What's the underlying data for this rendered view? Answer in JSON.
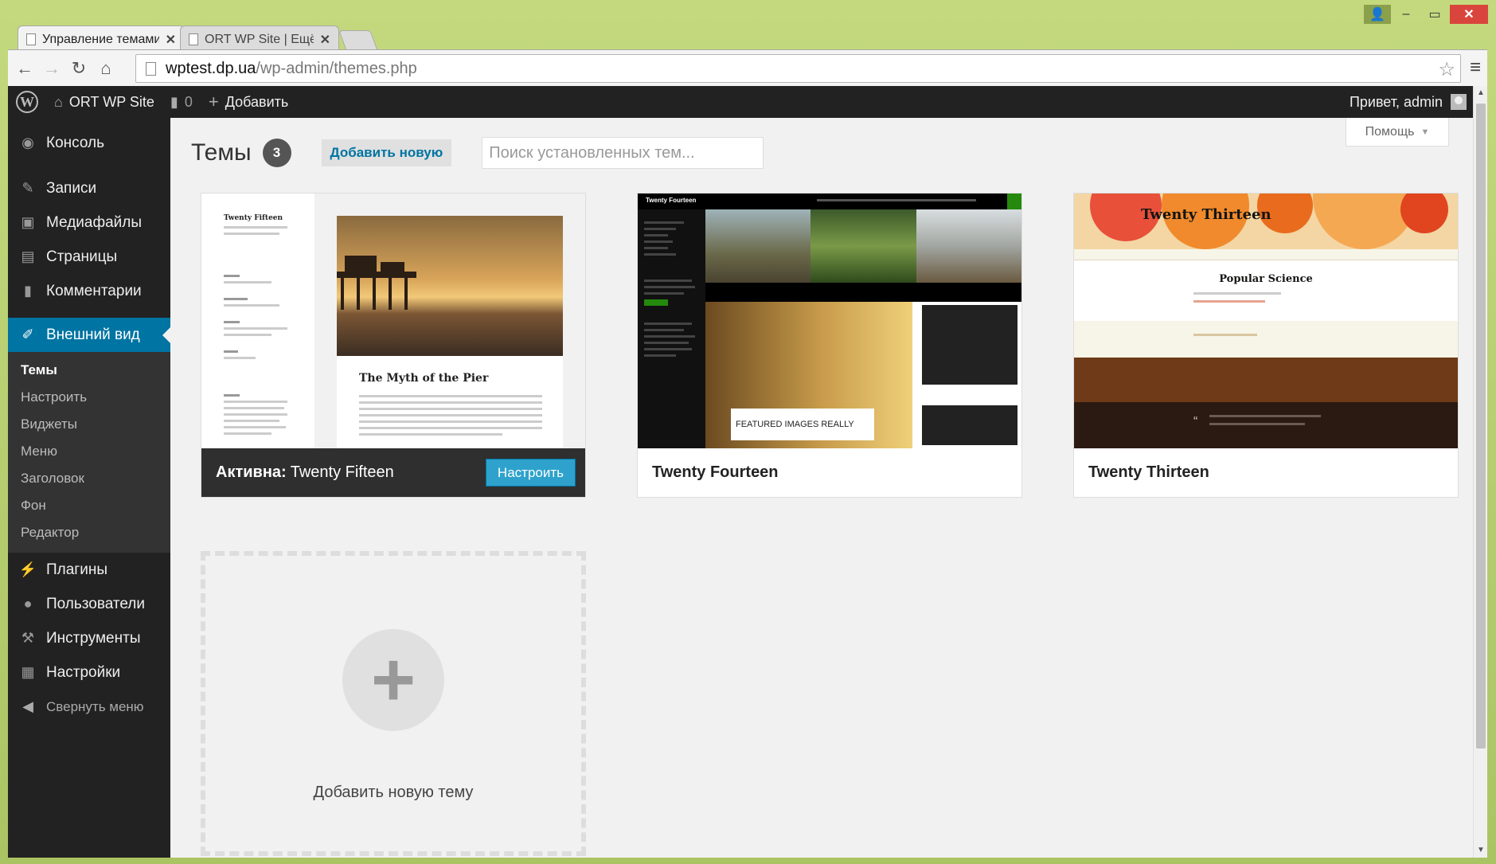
{
  "browser": {
    "tabs": [
      {
        "label": "Управление темами ‹ OR",
        "active": true
      },
      {
        "label": "ORT WP Site | Ещё один с",
        "active": false
      }
    ],
    "url_host": "wptest.dp.ua",
    "url_path": "/wp-admin/themes.php"
  },
  "adminbar": {
    "site_name": "ORT WP Site",
    "comments_count": "0",
    "new_label": "Добавить",
    "greeting": "Привет, admin"
  },
  "sidebar": {
    "items": [
      {
        "label": "Консоль",
        "icon": "dashboard-icon"
      },
      {
        "label": "Записи",
        "icon": "pin-icon"
      },
      {
        "label": "Медиафайлы",
        "icon": "media-icon"
      },
      {
        "label": "Страницы",
        "icon": "pages-icon"
      },
      {
        "label": "Комментарии",
        "icon": "comment-icon"
      },
      {
        "label": "Внешний вид",
        "icon": "brush-icon"
      }
    ],
    "submenu": [
      "Темы",
      "Настроить",
      "Виджеты",
      "Меню",
      "Заголовок",
      "Фон",
      "Редактор"
    ],
    "items_after": [
      {
        "label": "Плагины",
        "icon": "plugin-icon"
      },
      {
        "label": "Пользователи",
        "icon": "users-icon"
      },
      {
        "label": "Инструменты",
        "icon": "wrench-icon"
      },
      {
        "label": "Настройки",
        "icon": "settings-icon"
      }
    ],
    "collapse_label": "Свернуть меню"
  },
  "content": {
    "help_label": "Помощь",
    "title": "Темы",
    "count": "3",
    "add_new_label": "Добавить новую",
    "search_placeholder": "Поиск установленных тем...",
    "themes": [
      {
        "name": "Twenty Fifteen",
        "active_label": "Активна:",
        "customize_label": "Настроить",
        "shot_site_title": "Twenty Fifteen",
        "shot_post_title": "The Myth of the Pier"
      },
      {
        "name": "Twenty Fourteen",
        "shot_site_title": "Twenty Fourteen",
        "shot_featured": "FEATURED IMAGES REALLY"
      },
      {
        "name": "Twenty Thirteen",
        "shot_site_title": "Twenty Thirteen",
        "shot_post_title": "Popular Science"
      }
    ],
    "add_theme_label": "Добавить новую тему"
  },
  "colors": {
    "accent": "#0074a2",
    "button": "#2ea2cc",
    "admin_bar": "#222222",
    "browser_frame": "#b9cf72"
  }
}
